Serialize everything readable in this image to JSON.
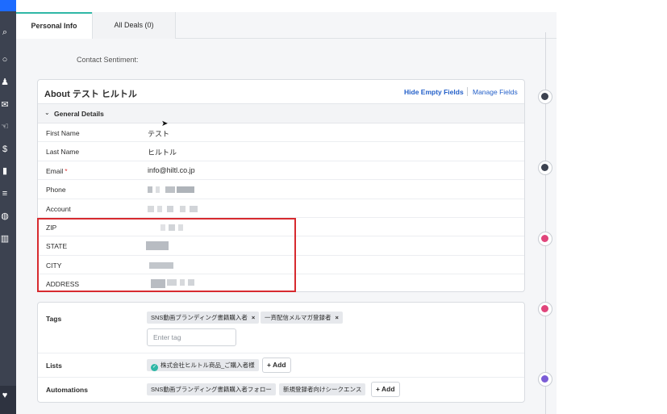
{
  "tabs": {
    "personal_info": "Personal Info",
    "all_deals": "All Deals (0)"
  },
  "contact_sentiment_label": "Contact Sentiment:",
  "about": {
    "title": "About テスト ヒルトル",
    "hide_empty_fields": "Hide Empty Fields",
    "manage_fields": "Manage Fields",
    "section_title": "General Details",
    "fields": [
      {
        "label": "First Name",
        "value": "テスト"
      },
      {
        "label": "Last Name",
        "value": "ヒルトル"
      },
      {
        "label": "Email",
        "value": "info@hiltl.co.jp",
        "required": "*"
      },
      {
        "label": "Phone",
        "value": ""
      },
      {
        "label": "Account",
        "value": ""
      },
      {
        "label": "ZIP",
        "value": ""
      },
      {
        "label": "STATE",
        "value": ""
      },
      {
        "label": "CITY",
        "value": ""
      },
      {
        "label": "ADDRESS",
        "value": ""
      }
    ]
  },
  "tags_section": {
    "tags_label": "Tags",
    "tags": [
      "SNS動画ブランディング書籍購入者",
      "一斉配信メルマガ登録者"
    ],
    "remove_symbol": "×",
    "enter_tag_placeholder": "Enter tag",
    "lists_label": "Lists",
    "list_item": "株式会社ヒルトル商品_ご購入者様",
    "add_label": "+ Add",
    "automations_label": "Automations",
    "automations": [
      "SNS動画ブランディング書籍購入者フォロー",
      "新規登録者向けシークエンス"
    ]
  },
  "colors": {
    "accent_teal": "#2fb7a6",
    "link_blue": "#2460c9",
    "highlight_red": "#d72a2f",
    "rail_dark": "#3c4250",
    "timeline_pink": "#e0457b",
    "timeline_purple": "#7b5cd6"
  },
  "timeline_icons": [
    "envelope-icon",
    "envelope-icon",
    "refresh-icon",
    "refresh-icon",
    "list-icon"
  ]
}
